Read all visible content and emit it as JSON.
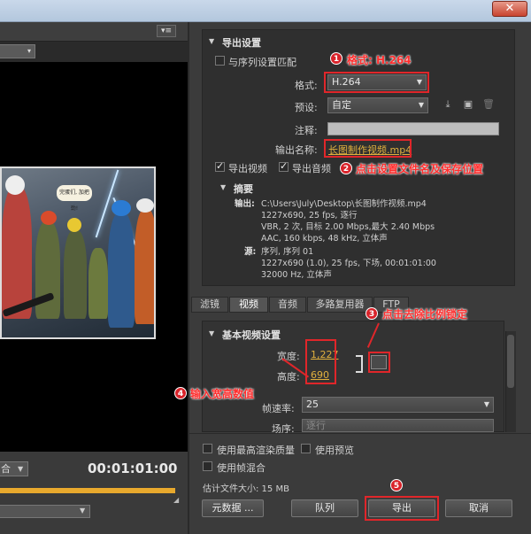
{
  "window": {
    "close_glyph": "✕"
  },
  "left": {
    "panel_menu_icon": "▾≡",
    "zoom_value": "合",
    "timecode": "00:01:01:00",
    "speech_bubble": "完蛋们, 加把劲!"
  },
  "export_settings": {
    "title": "导出设置",
    "match_sequence": "与序列设置匹配",
    "format_label": "格式:",
    "format_value": "H.264",
    "preset_label": "预设:",
    "preset_value": "自定",
    "notes_label": "注释:",
    "output_name_label": "输出名称:",
    "output_name_value": "长图制作视频.mp4",
    "export_video": "导出视频",
    "export_audio": "导出音频",
    "summary_title": "摘要",
    "output_label": "输出:",
    "output_lines": [
      "C:\\Users\\July\\Desktop\\长图制作视频.mp4",
      "1227x690, 25 fps, 逐行",
      "VBR, 2 次, 目标 2.00 Mbps,最大 2.40 Mbps",
      "AAC, 160 kbps, 48 kHz, 立体声"
    ],
    "source_label": "源:",
    "source_lines": [
      "序列, 序列 01",
      "1227x690 (1.0), 25 fps, 下场, 00:01:01:00",
      "32000 Hz, 立体声"
    ]
  },
  "tabs": [
    "滤镜",
    "视频",
    "音频",
    "多路复用器",
    "FTP"
  ],
  "video": {
    "section_title": "基本视频设置",
    "width_label": "宽度:",
    "width_value": "1,227",
    "height_label": "高度:",
    "height_value": "690",
    "framerate_label": "帧速率:",
    "framerate_value": "25",
    "field_order_label": "场序:",
    "field_order_value": "逐行"
  },
  "bottom": {
    "max_render_quality": "使用最高渲染质量",
    "use_previews": "使用预览",
    "frame_blending": "使用帧混合",
    "est_size": "估计文件大小: 15 MB",
    "metadata_button": "元数据 ...",
    "queue_button": "队列",
    "export_button": "导出",
    "cancel_button": "取消"
  },
  "annotations": {
    "a1_num": "1",
    "a1_text": "格式: H.264",
    "a2_num": "2",
    "a2_text": "点击设置文件名及保存位置",
    "a3_num": "3",
    "a3_text": "点击去除比例锁定",
    "a4_num": "4",
    "a4_text": "输入宽高数值",
    "a5_num": "5",
    "color": "#e0262a"
  }
}
